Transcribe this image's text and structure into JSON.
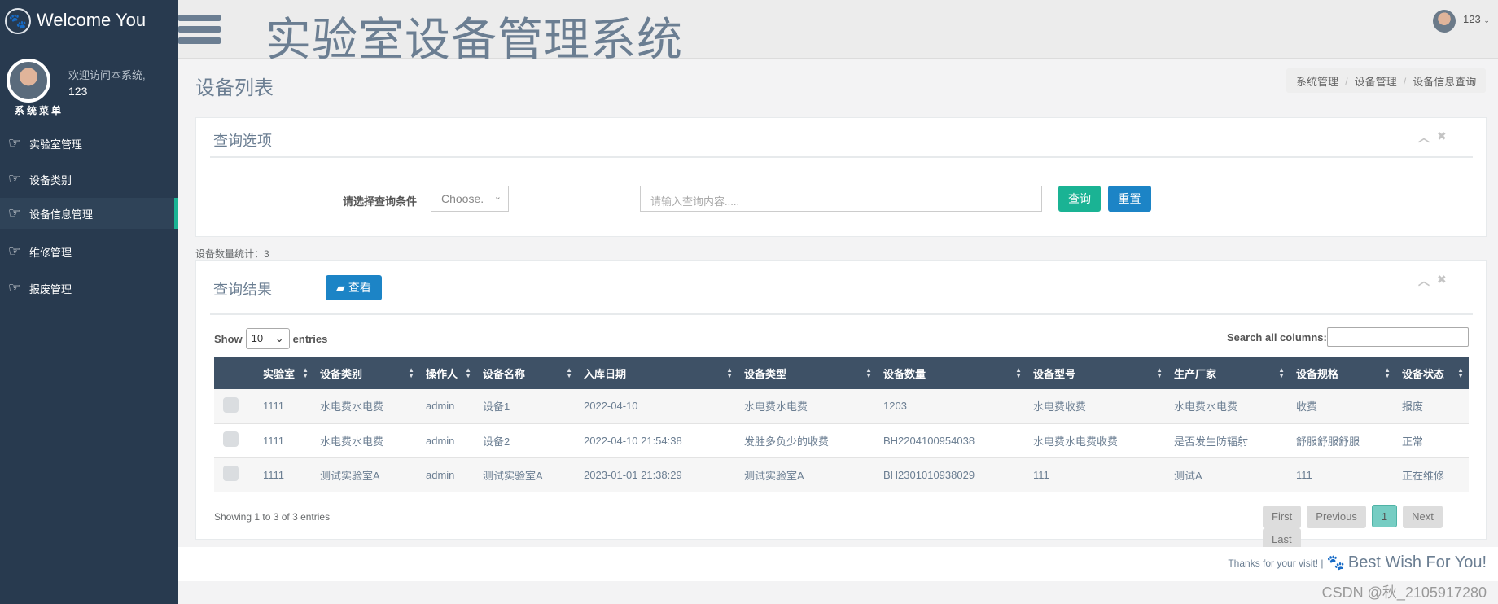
{
  "sidebar": {
    "brand": "Welcome You",
    "welcome": "欢迎访问本系统,",
    "username": "123",
    "menu_title": "系统菜单",
    "items": [
      {
        "label": "实验室管理"
      },
      {
        "label": "设备类别"
      },
      {
        "label": "设备信息管理",
        "active": true
      },
      {
        "label": "维修管理"
      },
      {
        "label": "报废管理"
      }
    ]
  },
  "header": {
    "title": "实验室设备管理系统",
    "user": "123"
  },
  "page": {
    "title": "设备列表",
    "breadcrumb": [
      "系统管理",
      "设备管理",
      "设备信息查询"
    ]
  },
  "query": {
    "title": "查询选项",
    "label": "请选择查询条件",
    "select_value": "Choose.",
    "input_placeholder": "请输入查询内容.....",
    "search_btn": "查询",
    "reset_btn": "重置"
  },
  "count_text": "设备数量统计：3",
  "results": {
    "title": "查询结果",
    "view_btn": "查看",
    "show": "Show",
    "entries_value": "10",
    "entries": "entries",
    "search_label": "Search all columns:",
    "columns": [
      "实验室",
      "设备类别",
      "操作人",
      "设备名称",
      "入库日期",
      "设备类型",
      "设备数量",
      "设备型号",
      "生产厂家",
      "设备规格",
      "设备状态"
    ],
    "rows": [
      [
        "1111",
        "水电费水电费",
        "admin",
        "设备1",
        "2022-04-10",
        "水电费水电费",
        "1203",
        "水电费收费",
        "水电费水电费",
        "收费",
        "报废"
      ],
      [
        "1111",
        "水电费水电费",
        "admin",
        "设备2",
        "2022-04-10 21:54:38",
        "发胜多负少的收费",
        "BH2204100954038",
        "水电费水电费收费",
        "是否发生防辐射",
        "舒服舒服舒服",
        "正常"
      ],
      [
        "1111",
        "测试实验室A",
        "admin",
        "测试实验室A",
        "2023-01-01 21:38:29",
        "测试实验室A",
        "BH2301010938029",
        "111",
        "测试A",
        "111",
        "正在维修"
      ]
    ],
    "info": "Showing 1 to 3 of 3 entries",
    "pagination": [
      "First",
      "Previous",
      "1",
      "Next",
      "Last"
    ]
  },
  "footer": {
    "thanks": "Thanks for your visit! |",
    "wish": "Best Wish For You!",
    "watermark": "CSDN @秋_2105917280"
  },
  "colors": {
    "sidebar": "#283a4f",
    "accent": "#1ab394",
    "primary": "#1c84c6",
    "table_header": "#3e5166"
  }
}
